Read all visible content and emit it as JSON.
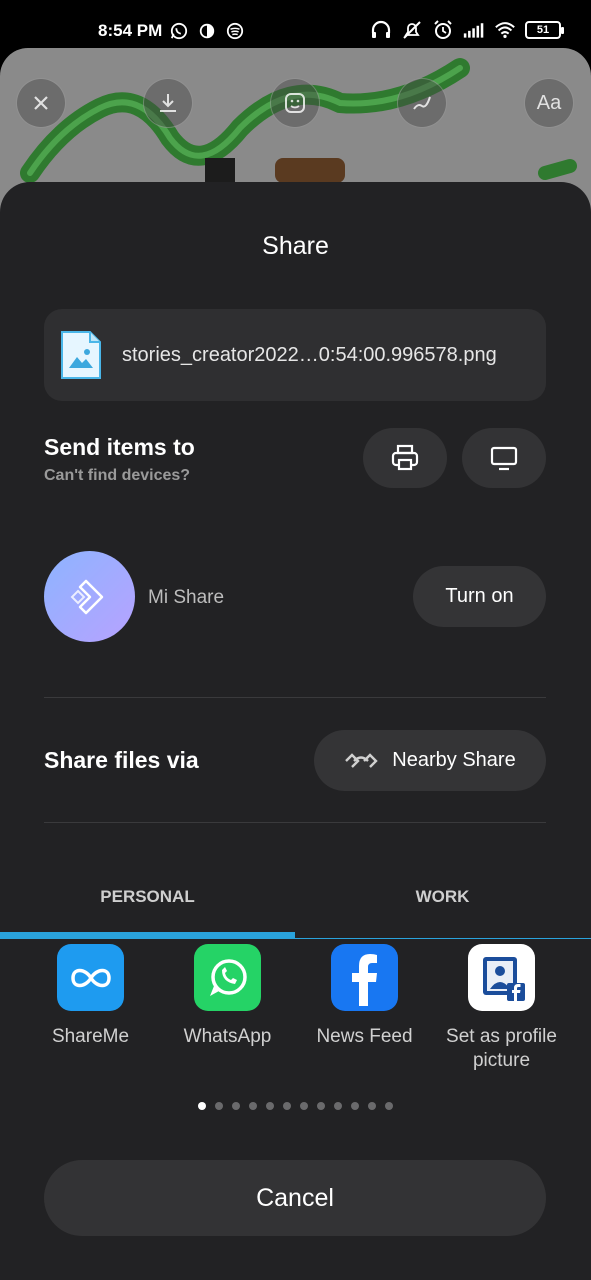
{
  "status_bar": {
    "time": "8:54 PM",
    "battery": "51",
    "left_icons": [
      "whatsapp-icon",
      "app-icon",
      "spotify-icon"
    ],
    "right_icons": [
      "headphones-icon",
      "mute-icon",
      "alarm-icon",
      "signal-icon",
      "wifi-icon"
    ]
  },
  "editor": {
    "tools": [
      "close-icon",
      "download-icon",
      "sticker-icon",
      "draw-icon",
      "text-icon"
    ],
    "text_tool_label": "Aa"
  },
  "sheet": {
    "title": "Share",
    "file": {
      "name": "stories_creator2022…0:54:00.996578.png",
      "icon": "image-file-icon"
    },
    "send_items": {
      "title": "Send items to",
      "subtitle": "Can't find devices?",
      "buttons": [
        "print-icon",
        "screen-cast-icon"
      ]
    },
    "mi_share": {
      "label": "Mi Share",
      "button": "Turn on"
    },
    "share_via": {
      "label": "Share files via",
      "nearby": "Nearby Share"
    },
    "tabs": [
      {
        "label": "PERSONAL",
        "active": true
      },
      {
        "label": "WORK",
        "active": false
      }
    ],
    "apps": [
      {
        "label": "ShareMe",
        "icon": "shareme-icon",
        "color": "#1e9bf0"
      },
      {
        "label": "WhatsApp",
        "icon": "whatsapp-icon",
        "color": "#25d366"
      },
      {
        "label": "News Feed",
        "icon": "facebook-icon",
        "color": "#1877f2"
      },
      {
        "label": "Set as profile picture",
        "icon": "profile-picture-icon",
        "color": "#ffffff"
      }
    ],
    "page_dots": {
      "count": 12,
      "active": 0
    },
    "cancel": "Cancel"
  },
  "colors": {
    "sheet_bg": "#222224",
    "accent": "#2aa3dc"
  }
}
